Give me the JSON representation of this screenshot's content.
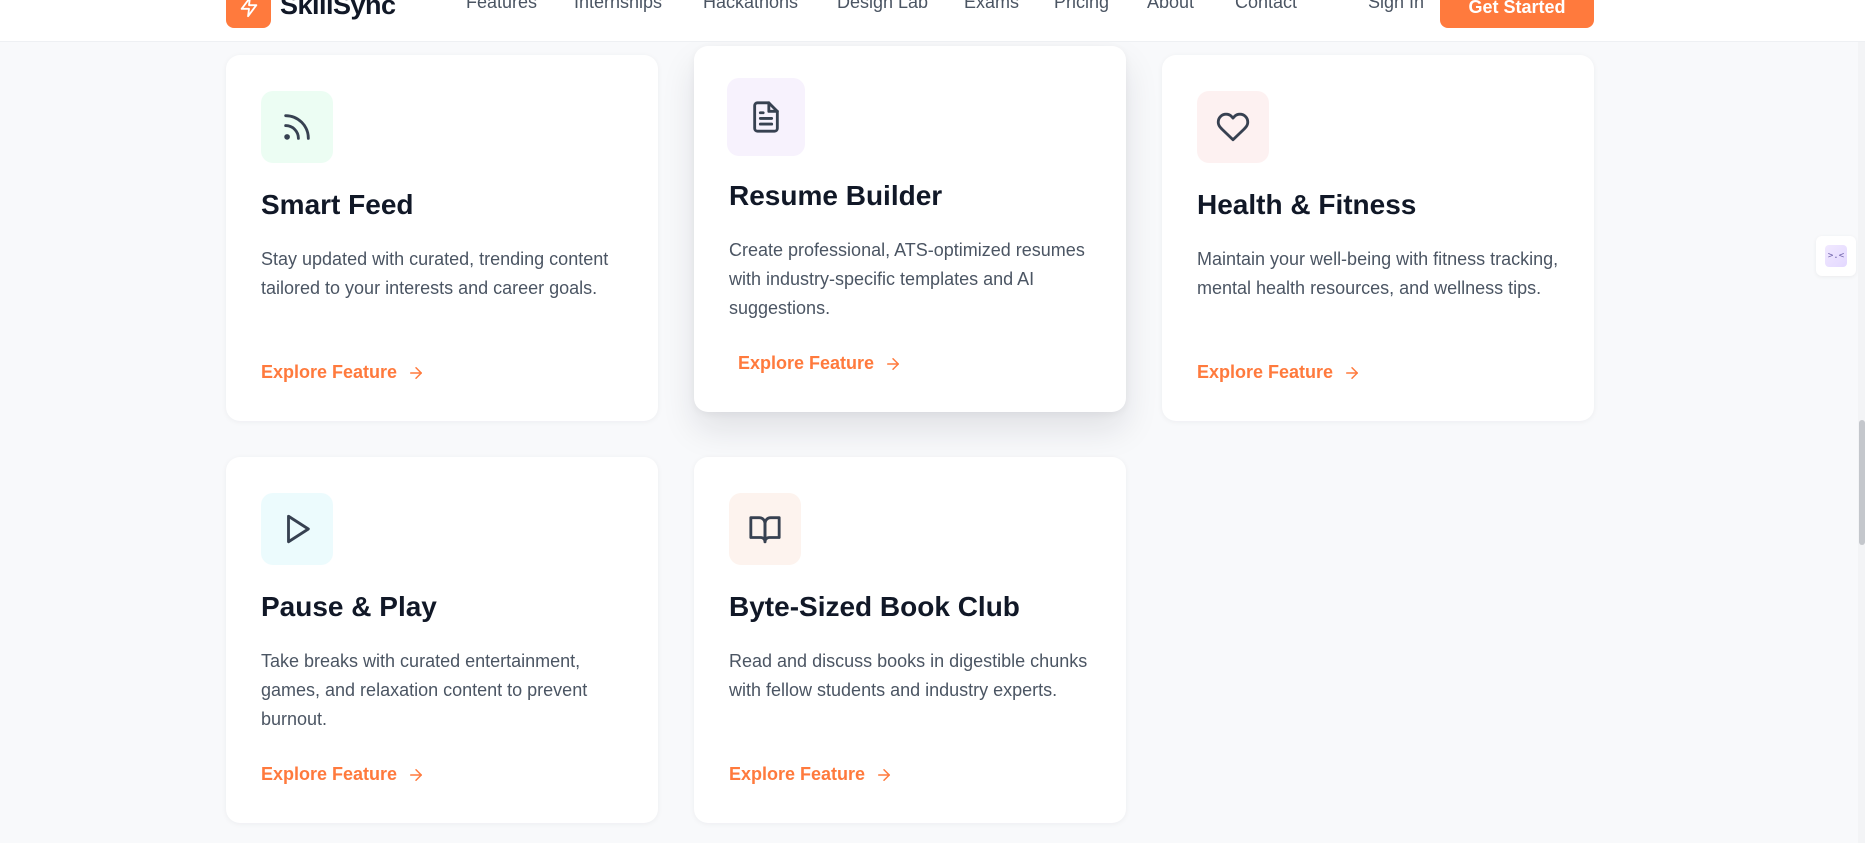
{
  "header": {
    "brand": "SkillSync",
    "nav": [
      "Features",
      "Internships",
      "Hackathons",
      "Design Lab",
      "Exams",
      "Pricing",
      "About",
      "Contact"
    ],
    "sign_in": "Sign In",
    "cta": "Get Started"
  },
  "colors": {
    "accent": "#ff7a3d",
    "title": "#111827",
    "body": "#4b5563"
  },
  "cards": [
    {
      "icon": "rss-icon",
      "icon_bg": "#ecfdf3",
      "title": "Smart Feed",
      "description": "Stay updated with curated, trending content tailored to your interests and career goals.",
      "link": "Explore Feature"
    },
    {
      "icon": "document-icon",
      "icon_bg": "#f7f2fd",
      "title": "Resume Builder",
      "description": "Create professional, ATS-optimized resumes with industry-specific templates and AI suggestions.",
      "link": "Explore Feature"
    },
    {
      "icon": "heart-icon",
      "icon_bg": "#fdf1f1",
      "title": "Health & Fitness",
      "description": "Maintain your well-being with fitness tracking, mental health resources, and wellness tips.",
      "link": "Explore Feature"
    },
    {
      "icon": "play-icon",
      "icon_bg": "#ecfbfd",
      "title": "Pause & Play",
      "description": "Take breaks with curated entertainment, games, and relaxation content to prevent burnout.",
      "link": "Explore Feature"
    },
    {
      "icon": "book-open-icon",
      "icon_bg": "#fdf3ee",
      "title": "Byte-Sized Book Club",
      "description": "Read and discuss books in digestible chunks with fellow students and industry experts.",
      "link": "Explore Feature"
    }
  ]
}
